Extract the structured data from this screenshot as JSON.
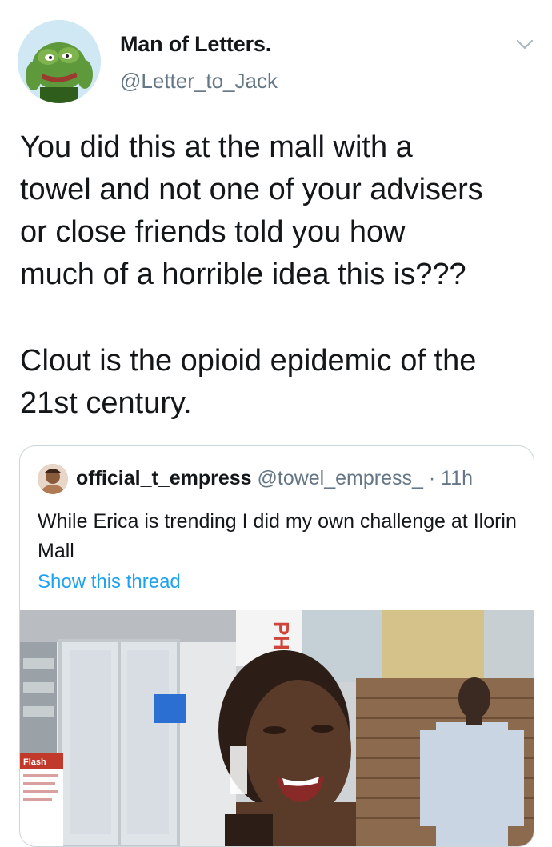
{
  "tweet": {
    "author_name": "Man of Letters.",
    "author_handle": "@Letter_to_Jack",
    "avatar_icon": "pepe-frog-avatar",
    "menu_icon": "chevron-down-icon",
    "text_para1": "You did this at the mall with a\ntowel and not one of your advisers\nor close friends told you how\nmuch of a horrible idea this is???",
    "text_para2": "Clout is the opioid epidemic of the\n21st century."
  },
  "quoted_tweet": {
    "author_name": "official_t_empress",
    "author_handle": "@towel_empress_",
    "separator": "·",
    "time": "11h",
    "text": "While Erica is trending I did my own challenge at Ilorin Mall",
    "show_thread_label": "Show this thread",
    "media": {
      "sign_flash": "Flash",
      "sign_letters": "PH"
    }
  },
  "colors": {
    "text": "#14171a",
    "secondary": "#657786",
    "link": "#1da1f2",
    "border": "#ccd6dd"
  }
}
